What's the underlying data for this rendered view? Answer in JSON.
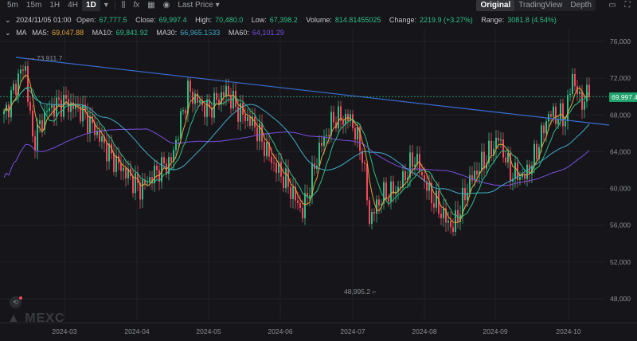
{
  "toolbar": {
    "intervals": [
      "5m",
      "15m",
      "1H",
      "4H",
      "1D"
    ],
    "active": "1D",
    "price_type": "Last Price",
    "views": [
      "Original",
      "TradingView",
      "Depth"
    ],
    "active_view": "Original"
  },
  "ohlc": {
    "date": "2024/11/05 01:00",
    "open_label": "Open:",
    "open": "67,777.5",
    "close_label": "Close:",
    "close": "69,997.4",
    "high_label": "High:",
    "high": "70,480.0",
    "low_label": "Low:",
    "low": "67,398.2",
    "volume_label": "Volume:",
    "volume": "814.81455025",
    "change_label": "Change:",
    "change": "2219.9 (+3.27%)",
    "range_label": "Range:",
    "range": "3081.8 (4.54%)"
  },
  "ma": {
    "label": "MA",
    "ma5_label": "MA5:",
    "ma5": "69,047.88",
    "ma10_label": "MA10:",
    "ma10": "69,841.92",
    "ma30_label": "MA30:",
    "ma30": "66,965.1533",
    "ma60_label": "MA60:",
    "ma60": "64,101.29"
  },
  "current_price": "69,997.4",
  "high_marker": "73,911.7",
  "low_marker": "48,995.2",
  "logo": "MEXC",
  "colors": {
    "up": "#2ebd85",
    "down": "#f6465d",
    "ma5": "#e8a33a",
    "ma10": "#2ebd85",
    "ma30": "#3fa9c9",
    "ma60": "#7a4de0",
    "trendline": "#3a6fd8"
  },
  "chart_data": {
    "type": "candlestick",
    "y_ticks": [
      "76,000",
      "72,000",
      "68,000",
      "64,000",
      "60,000",
      "56,000",
      "52,000",
      "48,000"
    ],
    "ylim": [
      48000,
      76000
    ],
    "x_ticks": [
      "2024-03",
      "2024-04",
      "2024-05",
      "2024-06",
      "2024-07",
      "2024-08",
      "2024-09",
      "2024-10"
    ],
    "close_keypoints_day_price": [
      [
        0,
        67800
      ],
      [
        7,
        72800
      ],
      [
        9,
        73000
      ],
      [
        12,
        65100
      ],
      [
        18,
        68500
      ],
      [
        25,
        69400
      ],
      [
        32,
        68500
      ],
      [
        38,
        66400
      ],
      [
        45,
        63400
      ],
      [
        57,
        60000
      ],
      [
        65,
        62100
      ],
      [
        70,
        63000
      ],
      [
        77,
        70600
      ],
      [
        85,
        68500
      ],
      [
        93,
        70600
      ],
      [
        98,
        68500
      ],
      [
        105,
        66800
      ],
      [
        112,
        63000
      ],
      [
        118,
        60800
      ],
      [
        125,
        57400
      ],
      [
        132,
        64300
      ],
      [
        138,
        67600
      ],
      [
        145,
        67600
      ],
      [
        150,
        63800
      ],
      [
        153,
        56600
      ],
      [
        158,
        59100
      ],
      [
        165,
        60000
      ],
      [
        172,
        63400
      ],
      [
        178,
        59500
      ],
      [
        185,
        56600
      ],
      [
        188,
        55700
      ],
      [
        195,
        60800
      ],
      [
        202,
        63400
      ],
      [
        207,
        65500
      ],
      [
        212,
        61700
      ],
      [
        218,
        61300
      ],
      [
        222,
        63400
      ],
      [
        228,
        68100
      ],
      [
        235,
        67700
      ],
      [
        238,
        72300
      ],
      [
        241,
        69500
      ],
      [
        245,
        69997
      ]
    ]
  }
}
